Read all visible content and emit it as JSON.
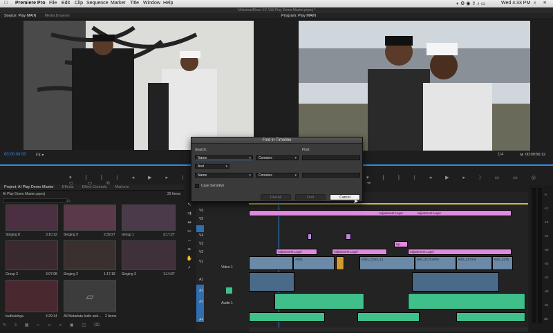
{
  "menubar": {
    "app": "Premiere Pro",
    "items": [
      "File",
      "Edit",
      "Clip",
      "Sequence",
      "Marker",
      "Title",
      "Window",
      "Help"
    ],
    "clock": "Wed 4:33 PM"
  },
  "titlebar": {
    "path": "/Volumes/Moon EV 1/AI Play Demo Master.prproj *"
  },
  "source": {
    "tabs": [
      "Source: Play MAIN",
      "Media Browser"
    ],
    "timecode": "00:00:00:00",
    "fit": "Fit"
  },
  "program": {
    "tab": "Program: Play MAIN",
    "fraction": "1/4",
    "timecode": "00:00:56:12"
  },
  "project": {
    "tabs": [
      "Project: AI Play Demo Master",
      "Effects",
      "Effect Controls",
      "Markers"
    ],
    "file": "AI Play Demo Master.prproj",
    "count": "29 Items",
    "bins": [
      {
        "name": "Singing 8",
        "dur": "3:10:12"
      },
      {
        "name": "Singing 9",
        "dur": "2:39:27"
      },
      {
        "name": "Group 1",
        "dur": "3:17:27"
      },
      {
        "name": "Group 2",
        "dur": "3:07:08"
      },
      {
        "name": "Singing 2",
        "dur": "1:17:18"
      },
      {
        "name": "Singing 3",
        "dur": "1:14:07"
      },
      {
        "name": "budhaishga",
        "dur": "4:29:14"
      },
      {
        "name": "All Metadata-Indin and...",
        "dur": "2 Items"
      }
    ]
  },
  "timeline": {
    "tracks_v": [
      "V6",
      "V5",
      "V4",
      "V3",
      "V2",
      "V1"
    ],
    "tracks_a": [
      "A1",
      "A2",
      "A3",
      "A4"
    ],
    "track_names": {
      "video1": "Video 1",
      "audio1": "Audio 1"
    },
    "clips": {
      "adj1": "Adjustment Layer",
      "adj2": "Adjustment Layer",
      "adj3": "Adjustment Layer",
      "adj4": "Adjustment Layer",
      "adj5": "Adjustment Layer",
      "up": "Up",
      "a003": "A003",
      "a001": "A001_C013_12",
      "img1": "IMG_2173.MOV",
      "img2": "IMG_2173.M",
      "img3": "IMG_3175"
    }
  },
  "dialog": {
    "title": "Find in Timeline",
    "search_label": "Search:",
    "find_label": "Find:",
    "field1": "Name",
    "op1": "Contains",
    "conj": "And",
    "field2": "Name",
    "op2": "Contains",
    "case": "Case Sensitive",
    "find_all": "Find All",
    "find": "Find",
    "cancel": "Cancel"
  },
  "meter_labels": [
    "-6",
    "-12",
    "-18",
    "-24",
    "-30",
    "-36",
    "-42",
    "-48",
    "-54",
    "dB"
  ]
}
